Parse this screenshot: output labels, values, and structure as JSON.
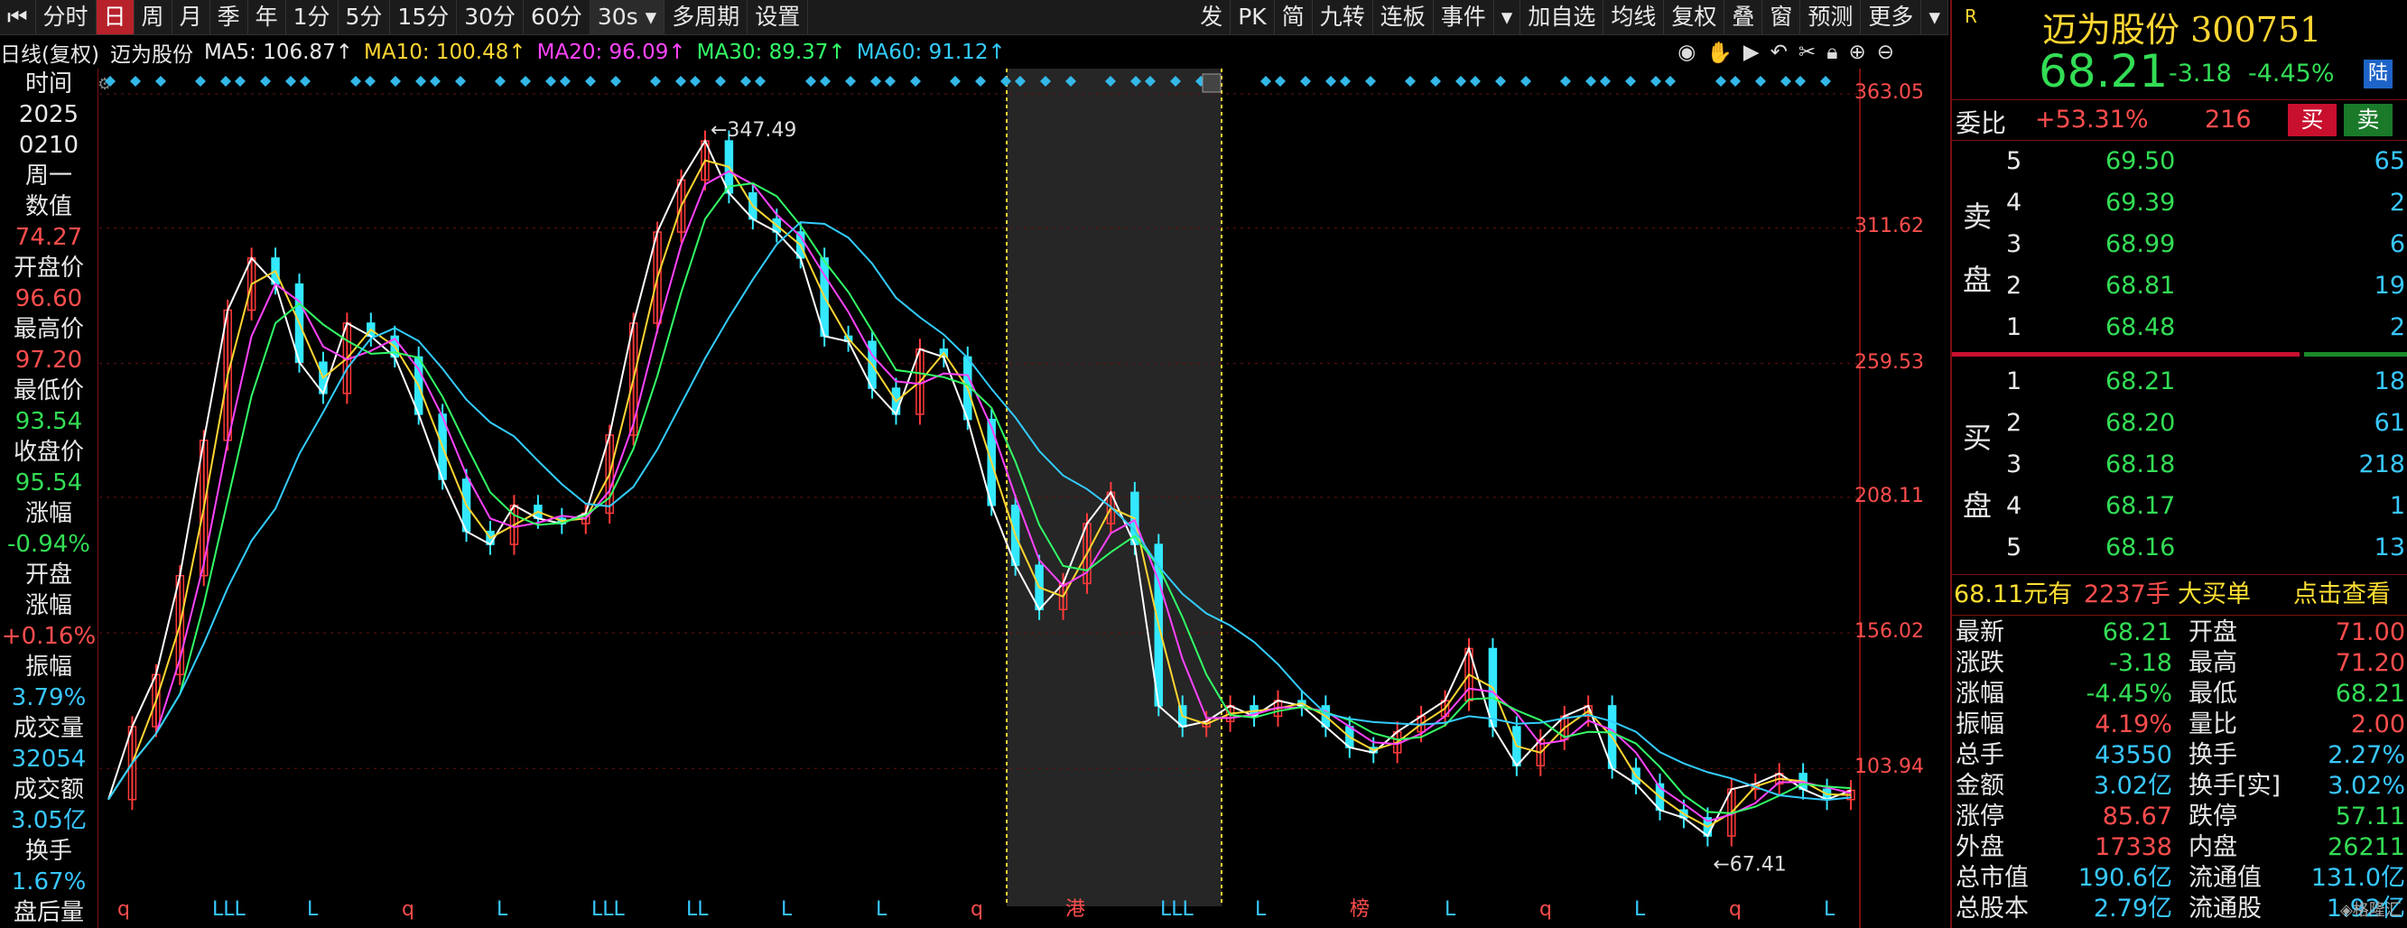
{
  "toolbar": {
    "left_items": [
      "分时",
      "日",
      "周",
      "月",
      "季",
      "年",
      "1分",
      "5分",
      "15分",
      "30分",
      "60分",
      "30s",
      "多周期",
      "设置"
    ],
    "active": "日",
    "right_items": [
      "发",
      "PK",
      "简",
      "九转",
      "连板",
      "事件",
      "加自选",
      "均线",
      "复权",
      "叠",
      "窗",
      "预测",
      "更多"
    ]
  },
  "ma_bar": {
    "period": "日线(复权)",
    "stock": "迈为股份",
    "ma5": "MA5: 106.87↑",
    "ma10": "MA10: 100.48↑",
    "ma20": "MA20: 96.09↑",
    "ma30": "MA30: 89.37↑",
    "ma60": "MA60: 91.12↑",
    "icons": [
      "eye-icon",
      "hand-icon",
      "play-icon",
      "undo-icon",
      "scissors-icon",
      "lock-icon",
      "zoom-in-icon",
      "zoom-out-icon"
    ]
  },
  "info_panel": {
    "time_label": "时间",
    "year": "2025",
    "date": "0210",
    "weekday": "周一",
    "value_label": "数值",
    "value": "74.27",
    "open_label": "开盘价",
    "open": "96.60",
    "high_label": "最高价",
    "high": "97.20",
    "low_label": "最低价",
    "low": "93.54",
    "close_label": "收盘价",
    "close": "95.54",
    "change_label": "涨幅",
    "change": "-0.94%",
    "open_change_label1": "开盘",
    "open_change_label2": "涨幅",
    "open_change": "+0.16%",
    "amplitude_label": "振幅",
    "amplitude": "3.79%",
    "volume_label": "成交量",
    "volume": "32054",
    "amount_label": "成交额",
    "amount": "3.05亿",
    "turnover_label": "换手",
    "turnover": "1.67%",
    "after_hours_label": "盘后量"
  },
  "chart": {
    "y_labels": [
      "363.05",
      "311.62",
      "259.53",
      "208.11",
      "156.02",
      "103.94"
    ],
    "high_marker": "347.49",
    "low_marker": "67.41",
    "bottom_marks": [
      "q",
      "LLL",
      "L",
      "q",
      "L",
      "LLL",
      "LL",
      "L",
      "L",
      "q",
      "港",
      "LLL",
      "L",
      "榜",
      "L",
      "q",
      "L",
      "q",
      "L"
    ],
    "colors": {
      "up": "#ff3a3a",
      "down": "#33e8ff",
      "ma5": "#ffffff",
      "ma10": "#ffd633",
      "ma20": "#ff44ff",
      "ma30": "#33ff66",
      "ma60": "#33ccff"
    },
    "close_icon": "close-icon"
  },
  "chart_data": {
    "type": "line",
    "title": "",
    "ylim": [
      60,
      370
    ],
    "series": [
      {
        "name": "K线",
        "values": [
          92,
          120,
          140,
          178,
          230,
          280,
          300,
          290,
          260,
          248,
          275,
          270,
          262,
          240,
          215,
          195,
          190,
          205,
          200,
          198,
          202,
          232,
          275,
          310,
          330,
          345,
          325,
          315,
          310,
          300,
          270,
          268,
          250,
          240,
          265,
          262,
          238,
          205,
          182,
          165,
          175,
          198,
          210,
          190,
          128,
          120,
          122,
          128,
          124,
          130,
          128,
          120,
          112,
          110,
          118,
          124,
          130,
          150,
          120,
          105,
          115,
          124,
          128,
          104,
          98,
          88,
          85,
          78,
          96,
          98,
          102,
          96,
          92,
          95.54
        ]
      }
    ]
  },
  "quote": {
    "tag": "R",
    "name": "迈为股份",
    "code": "300751",
    "price": "68.21",
    "change": "-3.18",
    "change_pct": "-4.45%",
    "board_tag": "陆",
    "webi_label": "委比",
    "webi_pct": "+53.31%",
    "webi_diff": "216",
    "buy_btn": "买",
    "sell_btn": "卖",
    "sell_label_1": "卖",
    "sell_label_2": "盘",
    "buy_label_1": "买",
    "buy_label_2": "盘",
    "asks": [
      {
        "level": "5",
        "price": "69.50",
        "vol": "65"
      },
      {
        "level": "4",
        "price": "69.39",
        "vol": "2"
      },
      {
        "level": "3",
        "price": "68.99",
        "vol": "6"
      },
      {
        "level": "2",
        "price": "68.81",
        "vol": "19"
      },
      {
        "level": "1",
        "price": "68.48",
        "vol": "2"
      }
    ],
    "bids": [
      {
        "level": "1",
        "price": "68.21",
        "vol": "18"
      },
      {
        "level": "2",
        "price": "68.20",
        "vol": "61"
      },
      {
        "level": "3",
        "price": "68.18",
        "vol": "218"
      },
      {
        "level": "4",
        "price": "68.17",
        "vol": "1"
      },
      {
        "level": "5",
        "price": "68.16",
        "vol": "13"
      }
    ],
    "big_order": {
      "price": "68.11元有",
      "qty": "2237手",
      "type": "大买单",
      "link": "点击查看"
    },
    "stats": [
      {
        "l1": "最新",
        "v1": "68.21",
        "c1": "green",
        "l2": "开盘",
        "v2": "71.00",
        "c2": "red"
      },
      {
        "l1": "涨跌",
        "v1": "-3.18",
        "c1": "green",
        "l2": "最高",
        "v2": "71.20",
        "c2": "red"
      },
      {
        "l1": "涨幅",
        "v1": "-4.45%",
        "c1": "green",
        "l2": "最低",
        "v2": "68.21",
        "c2": "green"
      },
      {
        "l1": "振幅",
        "v1": "4.19%",
        "c1": "red",
        "l2": "量比",
        "v2": "2.00",
        "c2": "red"
      },
      {
        "l1": "总手",
        "v1": "43550",
        "c1": "cyan",
        "l2": "换手",
        "v2": "2.27%",
        "c2": "cyan"
      },
      {
        "l1": "金额",
        "v1": "3.02亿",
        "c1": "cyan",
        "l2": "换手[实]",
        "v2": "3.02%",
        "c2": "cyan"
      },
      {
        "l1": "涨停",
        "v1": "85.67",
        "c1": "red",
        "l2": "跌停",
        "v2": "57.11",
        "c2": "green"
      },
      {
        "l1": "外盘",
        "v1": "17338",
        "c1": "red",
        "l2": "内盘",
        "v2": "26211",
        "c2": "green"
      },
      {
        "l1": "总市值",
        "v1": "190.6亿",
        "c1": "cyan",
        "l2": "流通值",
        "v2": "131.0亿",
        "c2": "cyan"
      },
      {
        "l1": "总股本",
        "v1": "2.79亿",
        "c1": "cyan",
        "l2": "流通股",
        "v2": "1.92亿",
        "c2": "cyan"
      }
    ]
  }
}
